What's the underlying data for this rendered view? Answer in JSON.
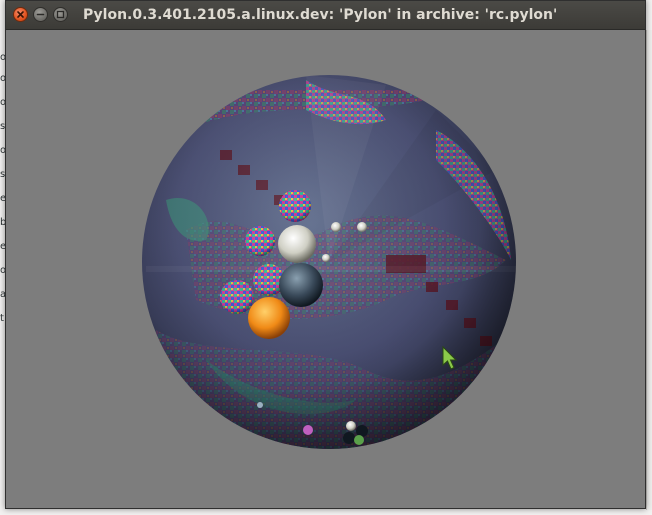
{
  "window": {
    "title": "Pylon.0.3.401.2105.a.linux.dev: 'Pylon' in archive: 'rc.pylon'"
  },
  "titlebar_buttons": {
    "close_icon": "close-icon",
    "minimize_icon": "minimize-icon",
    "maximize_icon": "maximize-icon"
  },
  "scene": {
    "background_color": "#7d7d7d",
    "planet_colors": [
      "#3d5a7a",
      "#6a4a7a",
      "#2f7a5a",
      "#8a3a5a",
      "#4a7aa0",
      "#9a6a3a"
    ],
    "cursor_icon": "pointer-arrow-icon",
    "cursor_color": "#6fa83c"
  },
  "background_app": {
    "fragments": [
      "o",
      "o",
      "o",
      "s",
      "o",
      "s",
      "e",
      "b",
      "e",
      "o",
      "a",
      "t"
    ]
  }
}
